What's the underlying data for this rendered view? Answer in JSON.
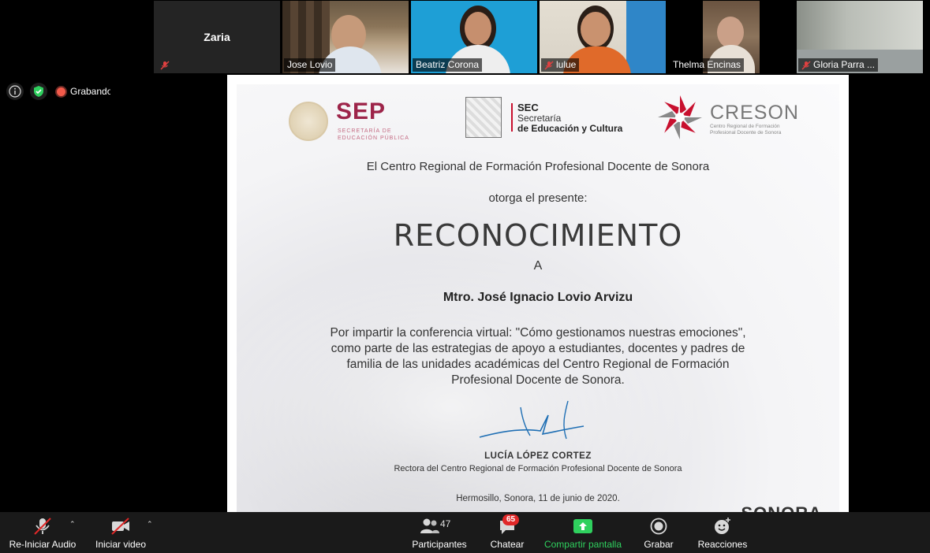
{
  "participants": [
    {
      "name": "Zaria",
      "muted": true,
      "video": false
    },
    {
      "name": "Jose Lovio",
      "muted": false,
      "video": true
    },
    {
      "name": "Beatriz Corona",
      "muted": false,
      "video": true,
      "active": true
    },
    {
      "name": "lulue",
      "muted": true,
      "video": true
    },
    {
      "name": "Thelma Encinas",
      "muted": false,
      "video": true
    },
    {
      "name": "Gloria Parra ...",
      "muted": true,
      "video": true
    }
  ],
  "status": {
    "recording_label": "Grabando"
  },
  "certificate": {
    "sep_title": "SEP",
    "sep_subtitle": "SECRETARÍA DE EDUCACIÓN PÚBLICA",
    "sec_title": "SEC",
    "sec_line1": "Secretaría",
    "sec_line2": "de Educación y Cultura",
    "creson_title": "CRESON",
    "creson_subtitle": "Centro Regional de Formación Profesional Docente de Sonora",
    "line1": "El Centro Regional de Formación Profesional Docente de Sonora",
    "line2": "otorga el presente:",
    "heading": "RECONOCIMIENTO",
    "to": "A",
    "recipient": "Mtro. José Ignacio Lovio Arvizu",
    "body": "Por impartir la conferencia virtual: \"Cómo gestionamos nuestras emociones\", como parte de las estrategias de apoyo a estudiantes, docentes y padres de familia de las unidades académicas del Centro Regional de Formación Profesional Docente de Sonora.",
    "signer": "LUCÍA LÓPEZ CORTEZ",
    "signer_role": "Rectora del Centro Regional de Formación Profesional Docente de Sonora",
    "place_date": "Hermosillo, Sonora, 11 de junio de 2020.",
    "footer_logo": "SONORA"
  },
  "toolbar": {
    "audio_label": "Re-Iniciar Audio",
    "video_label": "Iniciar video",
    "participants_label": "Participantes",
    "participants_count": "47",
    "chat_label": "Chatear",
    "chat_badge": "65",
    "share_label": "Compartir pantalla",
    "record_label": "Grabar",
    "reactions_label": "Reacciones"
  },
  "colors": {
    "share_green": "#2fd05e",
    "badge_red": "#e02828",
    "sep_maroon": "#9d2449"
  }
}
